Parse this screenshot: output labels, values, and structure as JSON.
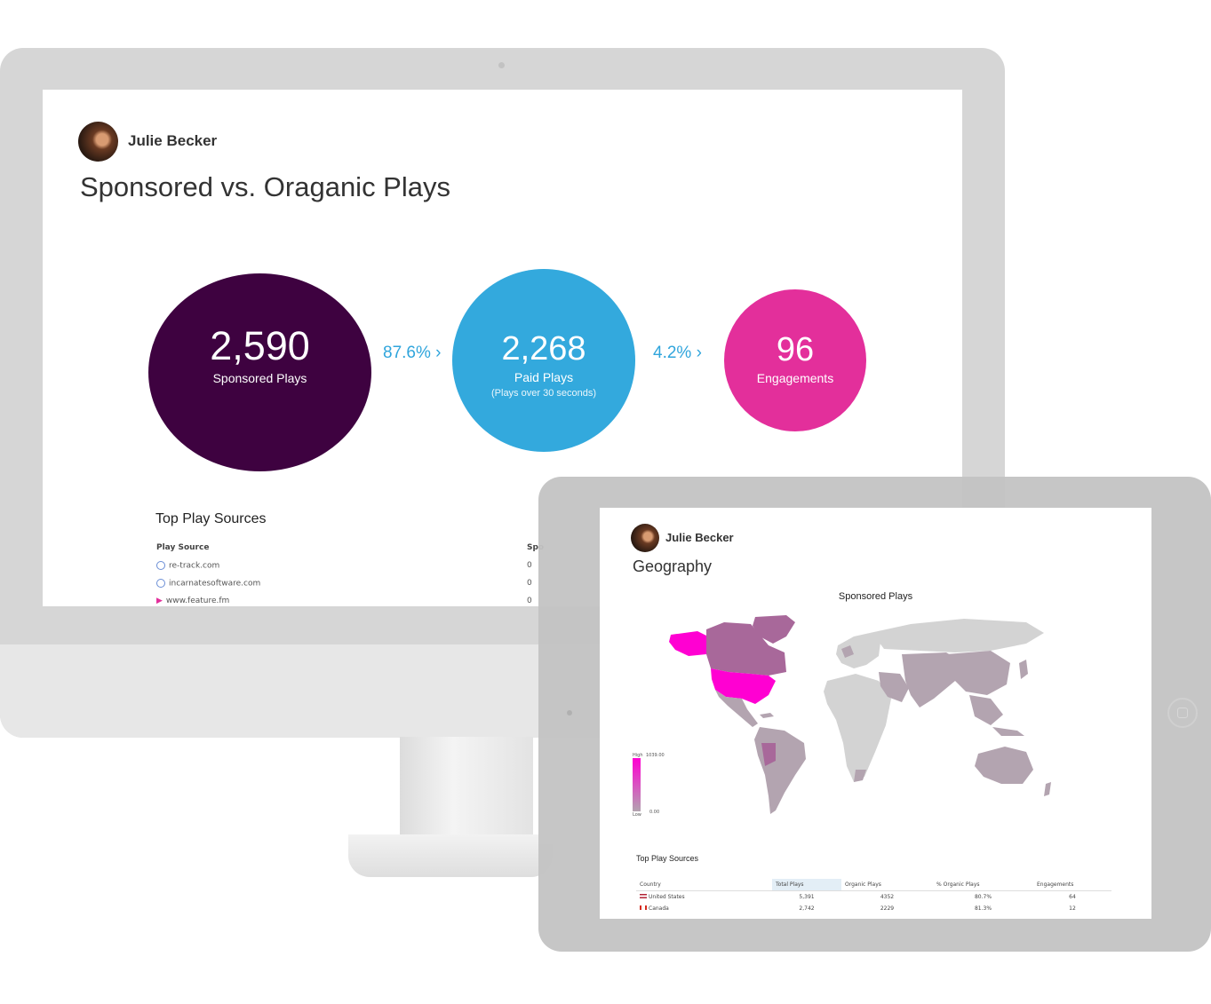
{
  "desktop": {
    "user_name": "Julie Becker",
    "page_title": "Sponsored vs. Oraganic Plays",
    "metrics": [
      {
        "value": "2,590",
        "label": "Sponsored Plays",
        "color": "#3e0240"
      },
      {
        "value": "2,268",
        "label": "Paid Plays",
        "sublabel": "(Plays over 30 seconds)",
        "color": "#33a9dd"
      },
      {
        "value": "96",
        "label": "Engagements",
        "color": "#e32f9b"
      }
    ],
    "rates": [
      "87.6% ›",
      "4.2% ›"
    ],
    "sources": {
      "title": "Top Play Sources",
      "column_source": "Play Source",
      "column_sponsored": "Spo",
      "rows": [
        {
          "name": "re-track.com",
          "value": "0"
        },
        {
          "name": "incarnatesoftware.com",
          "value": "0"
        },
        {
          "name": "www.feature.fm",
          "value": "0"
        }
      ]
    }
  },
  "tablet": {
    "user_name": "Julie Becker",
    "page_title": "Geography",
    "map_title": "Sponsored Plays",
    "legend": {
      "high": "High",
      "low": "Low",
      "max": "1039.00",
      "min": "0.00"
    },
    "map_colors": {
      "top": "#ff00d2",
      "mid": "#a8689a",
      "low": "#b3a4b0",
      "none": "#d3d3d3"
    },
    "table": {
      "title": "Top Play Sources",
      "columns": [
        "Country",
        "Total Plays",
        "Organic Plays",
        "% Organic Plays",
        "Engagements"
      ],
      "rows": [
        {
          "country": "United States",
          "total": "5,391",
          "organic": "4352",
          "pct": "80.7%",
          "engagements": "64"
        },
        {
          "country": "Canada",
          "total": "2,742",
          "organic": "2229",
          "pct": "81.3%",
          "engagements": "12"
        }
      ]
    }
  }
}
